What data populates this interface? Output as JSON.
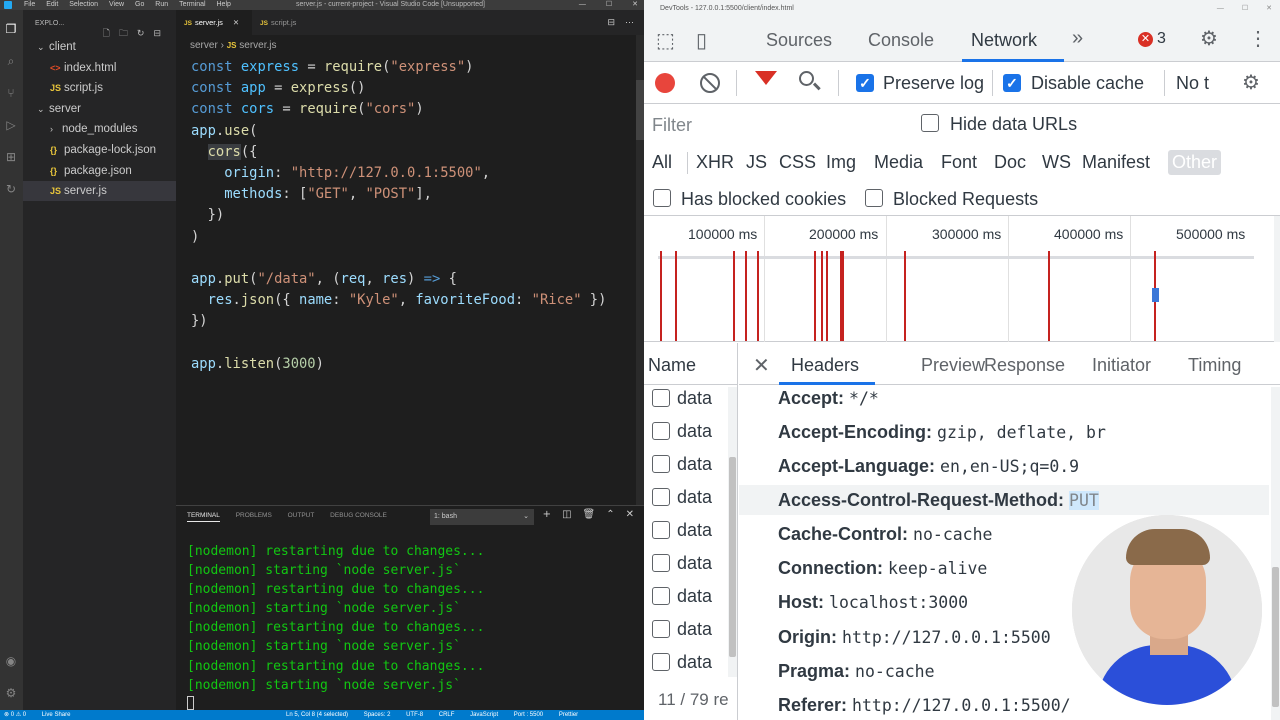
{
  "vscode": {
    "menu": [
      "File",
      "Edit",
      "Selection",
      "View",
      "Go",
      "Run",
      "Terminal",
      "Help"
    ],
    "window_title": "server.js - current-project - Visual Studio Code [Unsupported]",
    "sidebar_header": "EXPLO...",
    "tree": [
      {
        "label": "client",
        "kind": "folder-open"
      },
      {
        "label": "index.html",
        "kind": "html"
      },
      {
        "label": "script.js",
        "kind": "js"
      },
      {
        "label": "server",
        "kind": "folder-open"
      },
      {
        "label": "node_modules",
        "kind": "folder-closed"
      },
      {
        "label": "package-lock.json",
        "kind": "json"
      },
      {
        "label": "package.json",
        "kind": "json"
      },
      {
        "label": "server.js",
        "kind": "js",
        "selected": true
      }
    ],
    "tabs": [
      {
        "label": "server.js",
        "active": true
      },
      {
        "label": "script.js",
        "active": false
      }
    ],
    "breadcrumb": {
      "folder": "server",
      "file": "server.js"
    },
    "code": [
      [
        [
          "kw",
          "const"
        ],
        [
          "pl",
          " "
        ],
        [
          "cnst",
          "express"
        ],
        [
          "pl",
          " = "
        ],
        [
          "fn",
          "require"
        ],
        [
          "pl",
          "("
        ],
        [
          "str",
          "\"express\""
        ],
        [
          "pl",
          ")"
        ]
      ],
      [
        [
          "kw",
          "const"
        ],
        [
          "pl",
          " "
        ],
        [
          "cnst",
          "app"
        ],
        [
          "pl",
          " = "
        ],
        [
          "fn",
          "express"
        ],
        [
          "pl",
          "()"
        ]
      ],
      [
        [
          "kw",
          "const"
        ],
        [
          "pl",
          " "
        ],
        [
          "cnst",
          "cors"
        ],
        [
          "pl",
          " = "
        ],
        [
          "fn",
          "require"
        ],
        [
          "pl",
          "("
        ],
        [
          "str",
          "\"cors\""
        ],
        [
          "pl",
          ")"
        ]
      ],
      [
        [
          "var",
          "app"
        ],
        [
          "pl",
          "."
        ],
        [
          "fn",
          "use"
        ],
        [
          "pl",
          "("
        ]
      ],
      [
        [
          "pl",
          "  "
        ],
        [
          "fn",
          "cors"
        ],
        [
          "pl",
          "({"
        ]
      ],
      [
        [
          "pl",
          "    "
        ],
        [
          "var",
          "origin"
        ],
        [
          "pl",
          ": "
        ],
        [
          "str",
          "\"http://127.0.0.1:5500\""
        ],
        [
          "pl",
          ","
        ]
      ],
      [
        [
          "pl",
          "    "
        ],
        [
          "var",
          "methods"
        ],
        [
          "pl",
          ": ["
        ],
        [
          "str",
          "\"GET\""
        ],
        [
          "pl",
          ", "
        ],
        [
          "str",
          "\"POST\""
        ],
        [
          "pl",
          "],"
        ]
      ],
      [
        [
          "pl",
          "  })"
        ]
      ],
      [
        [
          "pl",
          ")"
        ]
      ],
      [],
      [
        [
          "var",
          "app"
        ],
        [
          "pl",
          "."
        ],
        [
          "fn",
          "put"
        ],
        [
          "pl",
          "("
        ],
        [
          "str",
          "\"/data\""
        ],
        [
          "pl",
          ", ("
        ],
        [
          "var",
          "req"
        ],
        [
          "pl",
          ", "
        ],
        [
          "var",
          "res"
        ],
        [
          "pl",
          ") "
        ],
        [
          "kw",
          "=>"
        ],
        [
          "pl",
          " {"
        ]
      ],
      [
        [
          "pl",
          "  "
        ],
        [
          "var",
          "res"
        ],
        [
          "pl",
          "."
        ],
        [
          "fn",
          "json"
        ],
        [
          "pl",
          "({ "
        ],
        [
          "var",
          "name"
        ],
        [
          "pl",
          ": "
        ],
        [
          "str",
          "\"Kyle\""
        ],
        [
          "pl",
          ", "
        ],
        [
          "var",
          "favoriteFood"
        ],
        [
          "pl",
          ": "
        ],
        [
          "str",
          "\"Rice\""
        ],
        [
          "pl",
          " })"
        ]
      ],
      [
        [
          "pl",
          "})"
        ]
      ],
      [],
      [
        [
          "var",
          "app"
        ],
        [
          "pl",
          "."
        ],
        [
          "fn",
          "listen"
        ],
        [
          "pl",
          "("
        ],
        [
          "num",
          "3000"
        ],
        [
          "pl",
          ")"
        ]
      ]
    ],
    "terminal": {
      "tabs": [
        "TERMINAL",
        "PROBLEMS",
        "OUTPUT",
        "DEBUG CONSOLE"
      ],
      "shell": "1: bash",
      "lines": [
        "[nodemon] restarting due to changes...",
        "[nodemon] starting `node server.js`",
        "[nodemon] restarting due to changes...",
        "[nodemon] starting `node server.js`",
        "[nodemon] restarting due to changes...",
        "[nodemon] starting `node server.js`",
        "[nodemon] restarting due to changes...",
        "[nodemon] starting `node server.js`"
      ]
    },
    "status_left": [
      "⊗ 0 ⚠ 0",
      "Live Share"
    ],
    "status_right": [
      "Ln 5, Col 8 (4 selected)",
      "Spaces: 2",
      "UTF-8",
      "CRLF",
      "JavaScript",
      "Port : 5500",
      "Prettier"
    ]
  },
  "devtools": {
    "window_title": "DevTools - 127.0.0.1:5500/client/index.html",
    "tabs": [
      "Sources",
      "Console",
      "Network"
    ],
    "active_tab": "Network",
    "error_count": "3",
    "preserve_log": "Preserve log",
    "disable_cache": "Disable cache",
    "throttle": "No t",
    "filter_placeholder": "Filter",
    "hide_data_urls": "Hide data URLs",
    "type_filters": [
      "All",
      "XHR",
      "JS",
      "CSS",
      "Img",
      "Media",
      "Font",
      "Doc",
      "WS",
      "Manifest",
      "Other"
    ],
    "active_type": "Other",
    "has_blocked_cookies": "Has blocked cookies",
    "blocked_requests": "Blocked Requests",
    "timeline_ticks": [
      "100000 ms",
      "200000 ms",
      "300000 ms",
      "400000 ms",
      "500000 ms"
    ],
    "name_header": "Name",
    "requests": [
      "data",
      "data",
      "data",
      "data",
      "data",
      "data",
      "data",
      "data",
      "data"
    ],
    "footer": "11 / 79 re",
    "detail_tabs": [
      "Headers",
      "Preview",
      "Response",
      "Initiator",
      "Timing"
    ],
    "headers": [
      {
        "key": "Accept:",
        "value": "*/*"
      },
      {
        "key": "Accept-Encoding:",
        "value": "gzip, deflate, br"
      },
      {
        "key": "Accept-Language:",
        "value": "en,en-US;q=0.9"
      },
      {
        "key": "Access-Control-Request-Method:",
        "value": "PUT",
        "highlight": true
      },
      {
        "key": "Cache-Control:",
        "value": "no-cache"
      },
      {
        "key": "Connection:",
        "value": "keep-alive"
      },
      {
        "key": "Host:",
        "value": "localhost:3000"
      },
      {
        "key": "Origin:",
        "value": "http://127.0.0.1:5500"
      },
      {
        "key": "Pragma:",
        "value": "no-cache"
      },
      {
        "key": "Referer:",
        "value": "http://127.0.0.1:5500/"
      }
    ],
    "colors": {
      "accent": "#1a73e8",
      "record": "#e8453c",
      "error": "#d93025"
    }
  }
}
